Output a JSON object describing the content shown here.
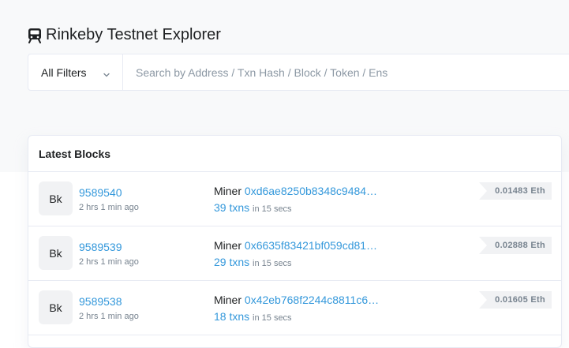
{
  "header": {
    "title": "Rinkeby Testnet Explorer",
    "logo_icon": "train-icon"
  },
  "search": {
    "filter_label": "All Filters",
    "placeholder": "Search by Address / Txn Hash / Block / Token / Ens",
    "value": ""
  },
  "latest_blocks": {
    "title": "Latest Blocks",
    "badge_label": "Bk",
    "miner_label": "Miner",
    "rows": [
      {
        "block": "9589540",
        "age": "2 hrs 1 min ago",
        "miner": "0xd6ae8250b8348c9484…",
        "txns": "39 txns",
        "duration": "in 15 secs",
        "reward": "0.01483 Eth"
      },
      {
        "block": "9589539",
        "age": "2 hrs 1 min ago",
        "miner": "0x6635f83421bf059cd81…",
        "txns": "29 txns",
        "duration": "in 15 secs",
        "reward": "0.02888 Eth"
      },
      {
        "block": "9589538",
        "age": "2 hrs 1 min ago",
        "miner": "0x42eb768f2244c8811c6…",
        "txns": "18 txns",
        "duration": "in 15 secs",
        "reward": "0.01605 Eth"
      }
    ]
  },
  "colors": {
    "link": "#3498db",
    "hero_bg": "#f8f9fa",
    "muted": "#77838f"
  }
}
